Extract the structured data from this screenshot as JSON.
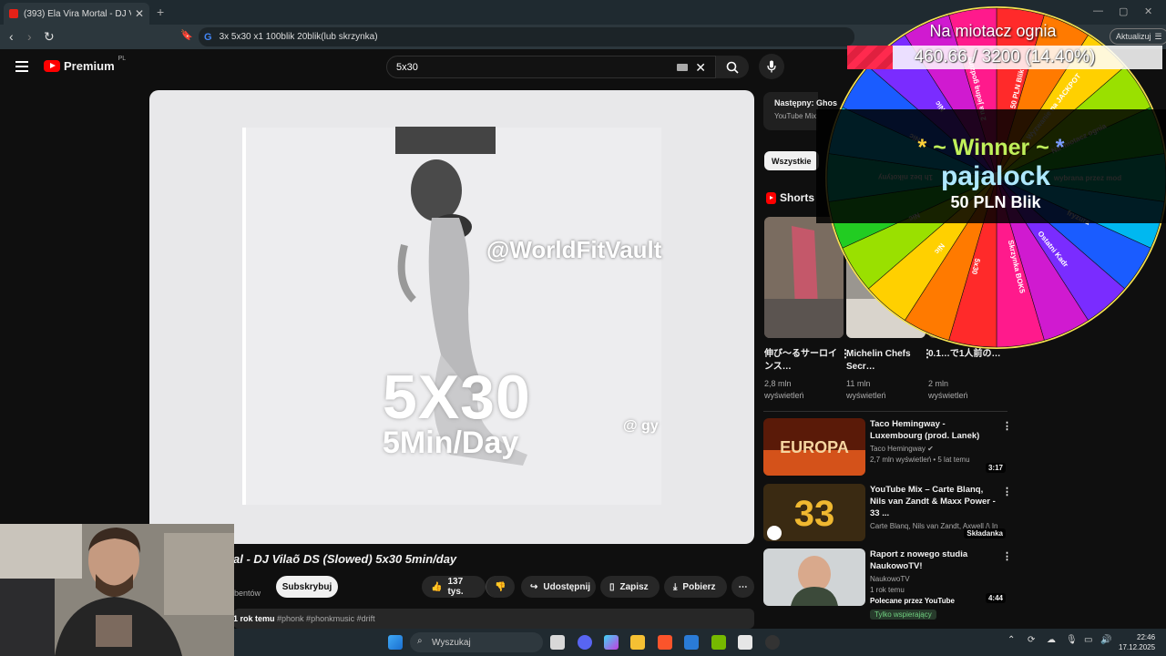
{
  "browser": {
    "tab_title": "(393) Ela Vira Mortal - DJ Vila",
    "address": "3x 5x30 x1 100blik 20blik(lub skrzynka)",
    "update_label": "Aktualizuj"
  },
  "youtube": {
    "logo_text": "Premium",
    "logo_region": "PL",
    "search_value": "5x30"
  },
  "video": {
    "watermark": "@WorldFitVault",
    "overlay_big": "5X30",
    "overlay_sub": "5Min/Day",
    "overlay_small": "@ gy",
    "title": "al - DJ Vilaõ DS (Slowed) 5x30 5min/day",
    "subs_label": "bentów",
    "subscribe_label": "Subskrybuj",
    "likes": "137 tys.",
    "share": "Udostępnij",
    "save": "Zapisz",
    "download": "Pobierz",
    "date": "1 rok temu",
    "tags": "#phonk #phonkmusic #drift"
  },
  "sidebar": {
    "next_title": "Następny: Ghos",
    "next_sub": "YouTube Mix",
    "chip": "Wszystkie",
    "shorts_label": "Shorts",
    "shorts": [
      {
        "title": "伸び～るサーロインス…",
        "views": "2,8 mln",
        "views_label": "wyświetleń"
      },
      {
        "title": "Michelin Chefs Secr…",
        "views": "11 mln",
        "views_label": "wyświetleń"
      },
      {
        "title": "0.1…で1人前の…",
        "views": "2 mln",
        "views_label": "wyświetleń"
      }
    ],
    "recs": [
      {
        "title": "Taco Hemingway - Luxembourg (prod. Lanek)",
        "channel": "Taco Hemingway",
        "meta": "2,7 mln wyświetleń • 5 lat temu",
        "duration": "3:17",
        "thumb_text": "EUROPA"
      },
      {
        "title": "YouTube Mix – Carte Blanq, Nils van Zandt & Maxx Power - 33 ...",
        "channel": "Carte Blanq, Nils van Zandt, Axwell /\\ Ing...",
        "meta": "",
        "duration": "Składanka",
        "thumb_text": "33"
      },
      {
        "title": "Raport z nowego studia NaukowoTV!",
        "channel": "NaukowoTV",
        "meta": "1 rok temu",
        "duration": "4:44",
        "extra": "Polecane przez YouTube",
        "badge": "Tylko wspierający"
      }
    ]
  },
  "overlay": {
    "wheel_title": "Na miotacz ognia",
    "progress_text": "460.66 / 3200 (14.40%)",
    "progress_fraction": 0.144,
    "winner_prefix": "*",
    "winner_text": "~ Winner ~",
    "winner_suffix": "*",
    "winner_name": "pajalock",
    "winner_prize": "50 PLN Blik",
    "wheel_labels": [
      "5x30",
      "Nic",
      "Nic",
      "1h bez nikotyny",
      "Nic",
      "Nic",
      "2 na jedną godzinę",
      "50 PLN Blik",
      "Wyzwanie na JACKPOT",
      "Na miotacz ognia",
      "wybrana przez mod",
      "fryzura",
      "Ostatni Kadr",
      "Skrzynka BOK5"
    ]
  },
  "taskbar": {
    "search_label": "Wyszukaj",
    "time": "22:46",
    "date": "17.12.2025"
  },
  "colors": {
    "yt_red": "#ff0000",
    "progress_red": "#ff2a4e",
    "winner_green": "#c0f05a",
    "winner_cyan": "#aee8ff"
  }
}
